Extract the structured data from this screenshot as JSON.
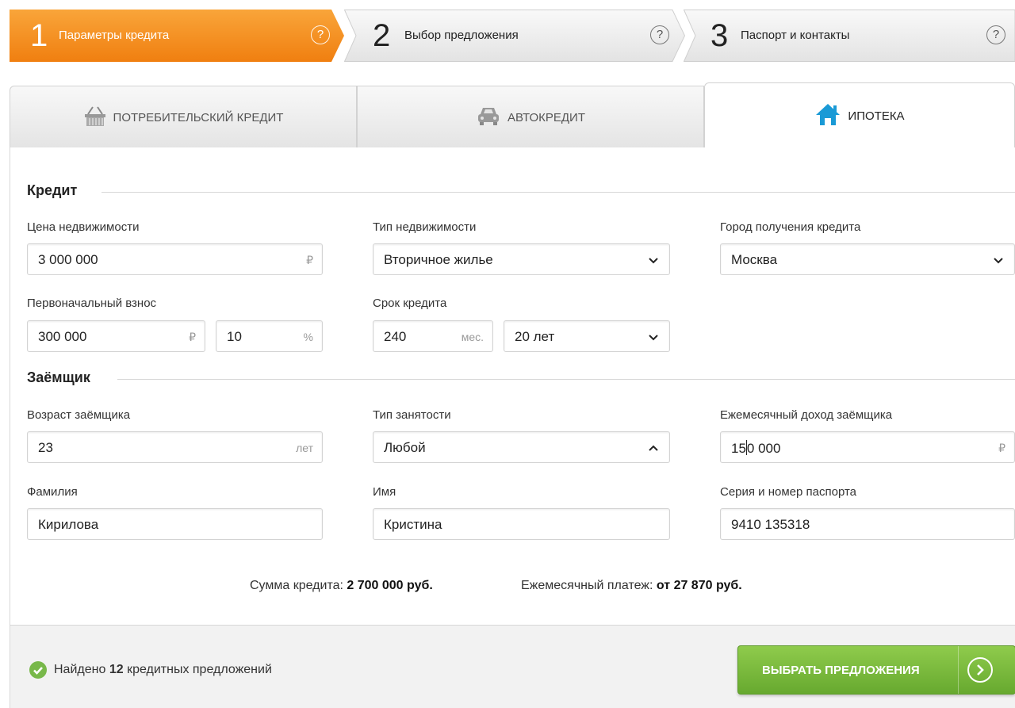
{
  "steps": [
    {
      "num": "1",
      "label": "Параметры кредита",
      "help": "?"
    },
    {
      "num": "2",
      "label": "Выбор предложения",
      "help": "?"
    },
    {
      "num": "3",
      "label": "Паспорт и контакты",
      "help": "?"
    }
  ],
  "tabs": [
    {
      "label": "ПОТРЕБИТЕЛЬСКИЙ КРЕДИТ",
      "icon": "basket-icon"
    },
    {
      "label": "АВТОКРЕДИТ",
      "icon": "car-icon"
    },
    {
      "label": "ИПОТЕКА",
      "icon": "house-icon"
    }
  ],
  "sections": {
    "credit": "Кредит",
    "borrower": "Заёмщик"
  },
  "fields": {
    "property_price": {
      "label": "Цена недвижимости",
      "value": "3 000 000",
      "suffix": "₽"
    },
    "property_type": {
      "label": "Тип недвижимости",
      "value": "Вторичное жилье"
    },
    "city": {
      "label": "Город получения кредита",
      "value": "Москва"
    },
    "down_payment": {
      "label": "Первоначальный взнос",
      "value": "300 000",
      "suffix": "₽",
      "percent": "10",
      "percent_suffix": "%"
    },
    "term": {
      "label": "Срок кредита",
      "months": "240",
      "months_suffix": "мес.",
      "years": "20 лет"
    },
    "age": {
      "label": "Возраст заёмщика",
      "value": "23",
      "suffix": "лет"
    },
    "employment": {
      "label": "Тип занятости",
      "value": "Любой"
    },
    "income": {
      "label": "Ежемесячный доход заёмщика",
      "value_before_caret": "15",
      "value_after_caret": "0 000",
      "suffix": "₽"
    },
    "last_name": {
      "label": "Фамилия",
      "value": "Кирилова"
    },
    "first_name": {
      "label": "Имя",
      "value": "Кристина"
    },
    "passport": {
      "label": "Серия и номер паспорта",
      "value": "9410 135318"
    }
  },
  "summary": {
    "amount_label": "Сумма кредита:",
    "amount_value": "2 700 000 руб.",
    "payment_label": "Ежемесячный платеж:",
    "payment_value": "от 27 870 руб."
  },
  "footer": {
    "found_prefix": "Найдено",
    "found_count": "12",
    "found_suffix": "кредитных предложений",
    "cta_label": "ВЫБРАТЬ ПРЕДЛОЖЕНИЯ"
  },
  "colors": {
    "active_step": "#f7941d",
    "cta_green": "#78b84a",
    "house_blue": "#1a9ad6"
  }
}
